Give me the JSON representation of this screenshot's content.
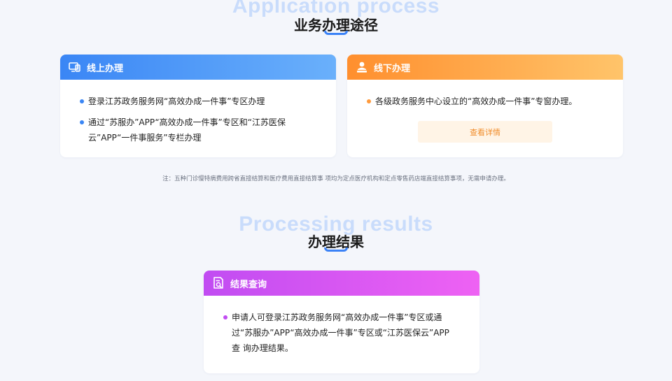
{
  "process": {
    "bg_title": "Application process",
    "title": "业务办理途径"
  },
  "online": {
    "title": "线上办理",
    "items": [
      "登录江苏政务服务网“高效办成一件事”专区办理",
      "通过“苏服办”APP“高效办成一件事”专区和“江苏医保云”APP“一件事服务”专栏办理"
    ]
  },
  "offline": {
    "title": "线下办理",
    "items": [
      "各级政务服务中心设立的“高效办成一件事”专窗办理。"
    ],
    "detail_button": "查看详情"
  },
  "note": "注：五种门诊慢特病费用跨省直接结算和医疗费用直接结算事 项均为定点医疗机构和定点零售药店端直接结算事项，无需申请办理。",
  "results": {
    "bg_title": "Processing results",
    "title": "办理结果"
  },
  "query": {
    "title": "结果查询",
    "items": [
      "申请人可登录江苏政务服务网“高效办成一件事”专区或通过“苏服办”APP“高效办成一件事”专区或“江苏医保云”APP查 询办理结果。"
    ]
  },
  "colors": {
    "blue": "#3a86f5",
    "orange": "#ff8f2e",
    "purple": "#c14cf2",
    "background": "#f4f6fb"
  },
  "icons": {
    "online": "devices-icon",
    "offline": "person-counter-icon",
    "query": "document-search-icon"
  }
}
